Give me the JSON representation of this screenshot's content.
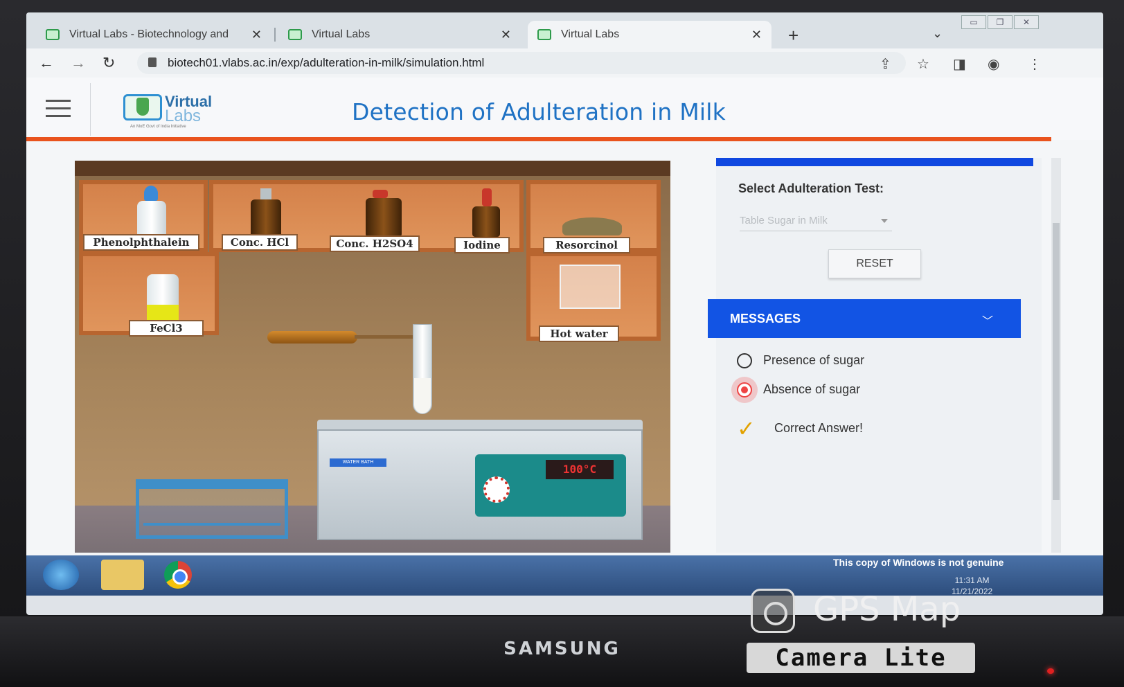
{
  "browser": {
    "tabs": [
      {
        "label": "Virtual Labs - Biotechnology and"
      },
      {
        "label": "Virtual Labs"
      },
      {
        "label": "Virtual Labs"
      }
    ],
    "url": "biotech01.vlabs.ac.in/exp/adulteration-in-milk/simulation.html"
  },
  "header": {
    "logo_line1": "Virtual",
    "logo_line2": "Labs",
    "logo_tagline": "An MoE Govt of India Initiative",
    "title": "Detection of Adulteration in Milk"
  },
  "simulation": {
    "reagents": [
      "Phenolphthalein",
      "Conc. HCl",
      "Conc. H2SO4",
      "Iodine",
      "Resorcinol",
      "FeCl3",
      "Hot water"
    ],
    "bath_tag": "WATER BATH",
    "temperature": "100°C"
  },
  "controls": {
    "select_label": "Select Adulteration Test:",
    "select_value": "Table Sugar in Milk",
    "reset_label": "RESET",
    "messages_title": "MESSAGES",
    "options": [
      {
        "label": "Presence of sugar",
        "selected": false
      },
      {
        "label": "Absence of sugar",
        "selected": true
      }
    ],
    "feedback": "Correct Answer!"
  },
  "taskbar": {
    "genuine_notice": "This copy of Windows is not genuine",
    "time": "11:31 AM",
    "date": "11/21/2022"
  },
  "monitor": {
    "brand": "SAMSUNG"
  },
  "watermark": {
    "line1": "GPS Map",
    "line2": "Camera Lite"
  }
}
